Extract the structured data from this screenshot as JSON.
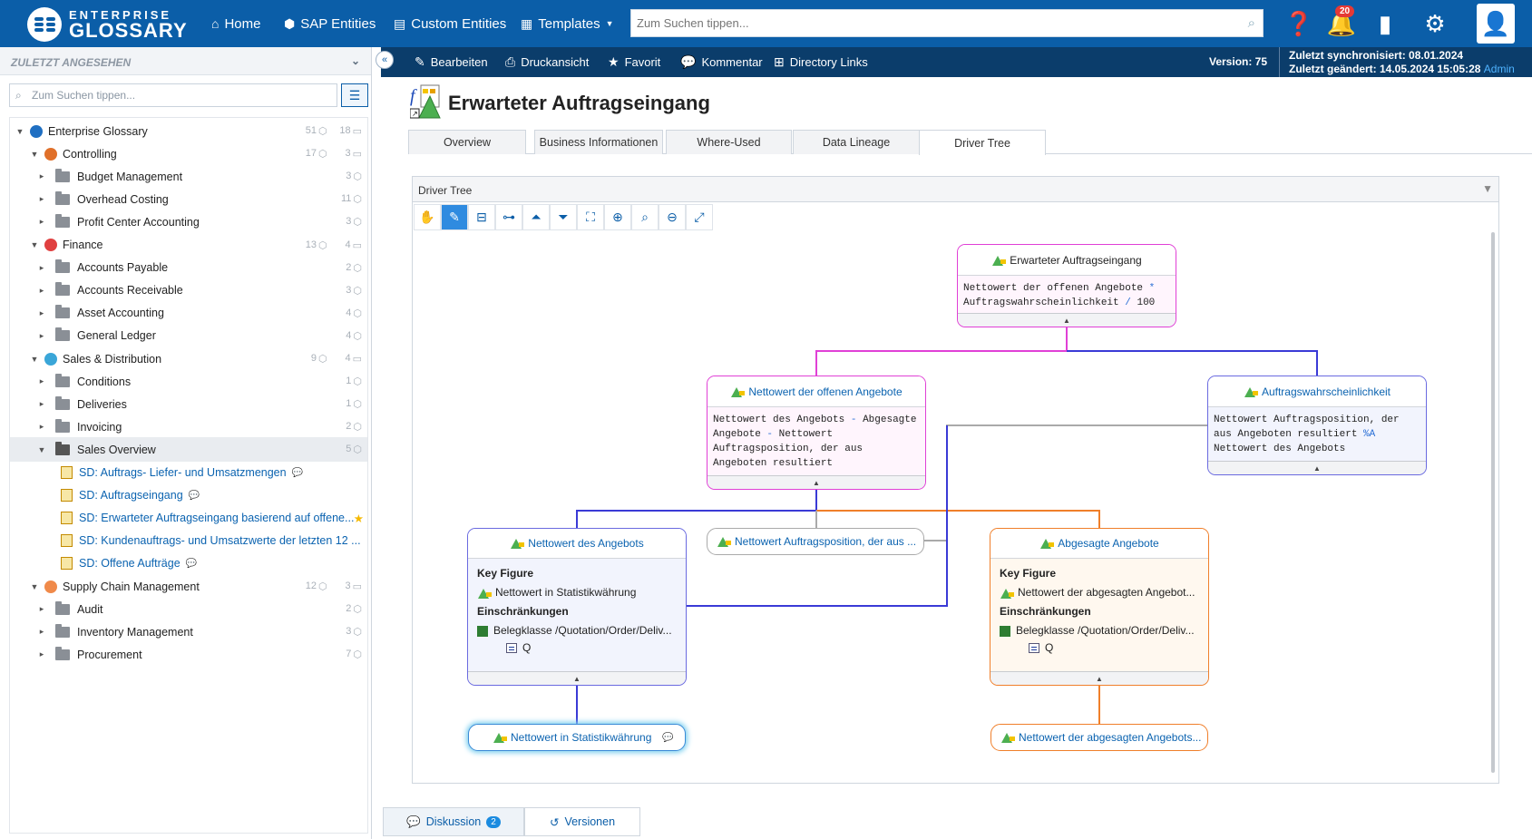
{
  "app": {
    "logo_line1": "ENTERPRISE",
    "logo_line2": "GLOSSARY",
    "nav": [
      "Home",
      "SAP Entities",
      "Custom Entities",
      "Templates"
    ],
    "search_placeholder": "Zum Suchen tippen...",
    "notification_count": "20"
  },
  "sidebar": {
    "recent_label": "ZULETZT ANGESEHEN",
    "search_placeholder": "Zum Suchen tippen...",
    "tree": [
      {
        "label": "Enterprise Glossary",
        "c1": "51",
        "c2": "18",
        "level": 0
      },
      {
        "label": "Controlling",
        "c1": "17",
        "c2": "3",
        "level": 1
      },
      {
        "label": "Budget Management",
        "c1": "3",
        "c2": "",
        "level": 2
      },
      {
        "label": "Overhead Costing",
        "c1": "11",
        "c2": "",
        "level": 2
      },
      {
        "label": "Profit Center Accounting",
        "c1": "3",
        "c2": "",
        "level": 2
      },
      {
        "label": "Finance",
        "c1": "13",
        "c2": "4",
        "level": 1
      },
      {
        "label": "Accounts Payable",
        "c1": "2",
        "c2": "",
        "level": 2
      },
      {
        "label": "Accounts Receivable",
        "c1": "3",
        "c2": "",
        "level": 2
      },
      {
        "label": "Asset Accounting",
        "c1": "4",
        "c2": "",
        "level": 2
      },
      {
        "label": "General Ledger",
        "c1": "4",
        "c2": "",
        "level": 2
      },
      {
        "label": "Sales & Distribution",
        "c1": "9",
        "c2": "4",
        "level": 1
      },
      {
        "label": "Conditions",
        "c1": "1",
        "c2": "",
        "level": 2
      },
      {
        "label": "Deliveries",
        "c1": "1",
        "c2": "",
        "level": 2
      },
      {
        "label": "Invoicing",
        "c1": "2",
        "c2": "",
        "level": 2
      },
      {
        "label": "Sales Overview",
        "c1": "5",
        "c2": "",
        "level": 2
      },
      {
        "label": "SD: Auftrags- Liefer- und Umsatzmengen",
        "c1": "",
        "c2": "",
        "level": 3
      },
      {
        "label": "SD: Auftragseingang",
        "c1": "",
        "c2": "",
        "level": 3
      },
      {
        "label": "SD: Erwarteter Auftragseingang basierend auf offene...",
        "c1": "",
        "c2": "",
        "level": 3
      },
      {
        "label": "SD: Kundenauftrags- und Umsatzwerte der letzten 12 ...",
        "c1": "",
        "c2": "",
        "level": 3
      },
      {
        "label": "SD: Offene Aufträge",
        "c1": "",
        "c2": "",
        "level": 3
      },
      {
        "label": "Supply Chain Management",
        "c1": "12",
        "c2": "3",
        "level": 1
      },
      {
        "label": "Audit",
        "c1": "2",
        "c2": "",
        "level": 2
      },
      {
        "label": "Inventory Management",
        "c1": "3",
        "c2": "",
        "level": 2
      },
      {
        "label": "Procurement",
        "c1": "7",
        "c2": "",
        "level": 2
      }
    ]
  },
  "actionbar": {
    "items": [
      "Bearbeiten",
      "Druckansicht",
      "Favorit",
      "Kommentar",
      "Directory Links"
    ],
    "version": "Version: 75",
    "synced": "Zuletzt synchronisiert: 08.01.2024",
    "changed": "Zuletzt geändert: 14.05.2024 15:05:28",
    "changed_by": "Admin"
  },
  "page": {
    "title": "Erwarteter Auftragseingang",
    "tabs": [
      "Overview",
      "Business Informationen",
      "Where-Used",
      "Data Lineage",
      "Driver Tree"
    ],
    "active_tab": "Driver Tree",
    "panel_title": "Driver Tree"
  },
  "tree_nodes": {
    "root": {
      "title": "Erwarteter Auftragseingang",
      "f1": "Nettowert der offenen Angebote",
      "op1": "*",
      "f2": "Auftragswahrscheinlichkeit",
      "op2": "/",
      "f3": "100"
    },
    "left": {
      "title": "Nettowert der offenen Angebote",
      "f1": "Nettowert des Angebots",
      "op1": "-",
      "f2": "Abgesagte",
      "f3": "Angebote",
      "op2": "-",
      "f4": "Nettowert",
      "f5": "Auftragsposition, der aus",
      "f6": "Angeboten resultiert"
    },
    "right": {
      "title": "Auftragswahrscheinlichkeit",
      "f1": "Nettowert Auftragsposition, der",
      "f2": "aus Angeboten resultiert",
      "op1": "%A",
      "f3": "Nettowert des Angebots"
    },
    "kf1": {
      "title": "Nettowert des Angebots",
      "h1": "Key Figure",
      "item1": "Nettowert in Statistikwährung",
      "h2": "Einschränkungen",
      "item2": "Belegklasse /Quotation/Order/Deliv...",
      "val": "Q"
    },
    "mid_pill": "Nettowert Auftragsposition, der aus ...",
    "kf2": {
      "title": "Abgesagte Angebote",
      "h1": "Key Figure",
      "item1": "Nettowert der abgesagten Angebot...",
      "h2": "Einschränkungen",
      "item2": "Belegklasse /Quotation/Order/Deliv...",
      "val": "Q"
    },
    "leaf1": "Nettowert in Statistikwährung",
    "leaf2": "Nettowert der abgesagten Angebots..."
  },
  "bottom": {
    "discussion": "Diskussion",
    "discussion_count": "2",
    "versions": "Versionen"
  }
}
